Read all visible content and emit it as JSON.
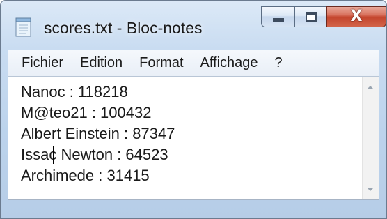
{
  "window": {
    "title": "scores.txt - Bloc-notes",
    "icon": "notepad-icon"
  },
  "caption_buttons": {
    "minimize": "minimize-icon",
    "maximize": "maximize-icon",
    "close_label": "X"
  },
  "menu": {
    "items": [
      {
        "label": "Fichier"
      },
      {
        "label": "Edition"
      },
      {
        "label": "Format"
      },
      {
        "label": "Affichage"
      },
      {
        "label": "?"
      }
    ]
  },
  "editor": {
    "lines": [
      "Nanoc : 118218",
      "M@teo21 : 100432",
      "Albert Einstein : 87347",
      "Issac Newton : 64523",
      "Archimede : 31415"
    ]
  },
  "colors": {
    "close_button": "#c4452d",
    "frame": "#bcd3ec"
  }
}
